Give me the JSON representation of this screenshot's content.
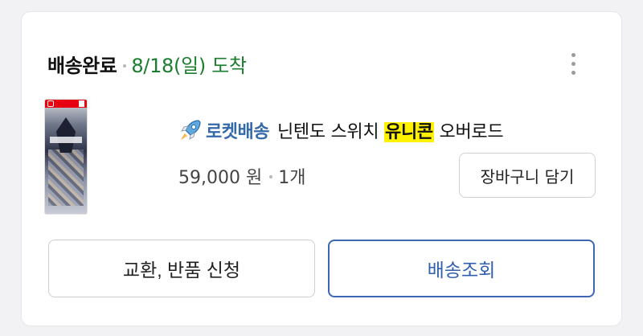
{
  "order": {
    "status": "배송완료",
    "arrival": "8/18(일) 도착"
  },
  "product": {
    "delivery_badge": "로켓배송",
    "name_before": "닌텐도 스위치 ",
    "name_highlight": "유니콘",
    "name_after": " 오버로드",
    "price": "59,000 원",
    "quantity": "1개",
    "thumbnail_icon": "game-cover-image"
  },
  "actions": {
    "add_to_cart": "장바구니 담기",
    "exchange_return": "교환, 반품 신청",
    "track_delivery": "배송조회"
  },
  "colors": {
    "status_green": "#1b7d2e",
    "rocket_blue": "#346aa9",
    "track_blue": "#3d66b3",
    "highlight": "#fff200"
  }
}
